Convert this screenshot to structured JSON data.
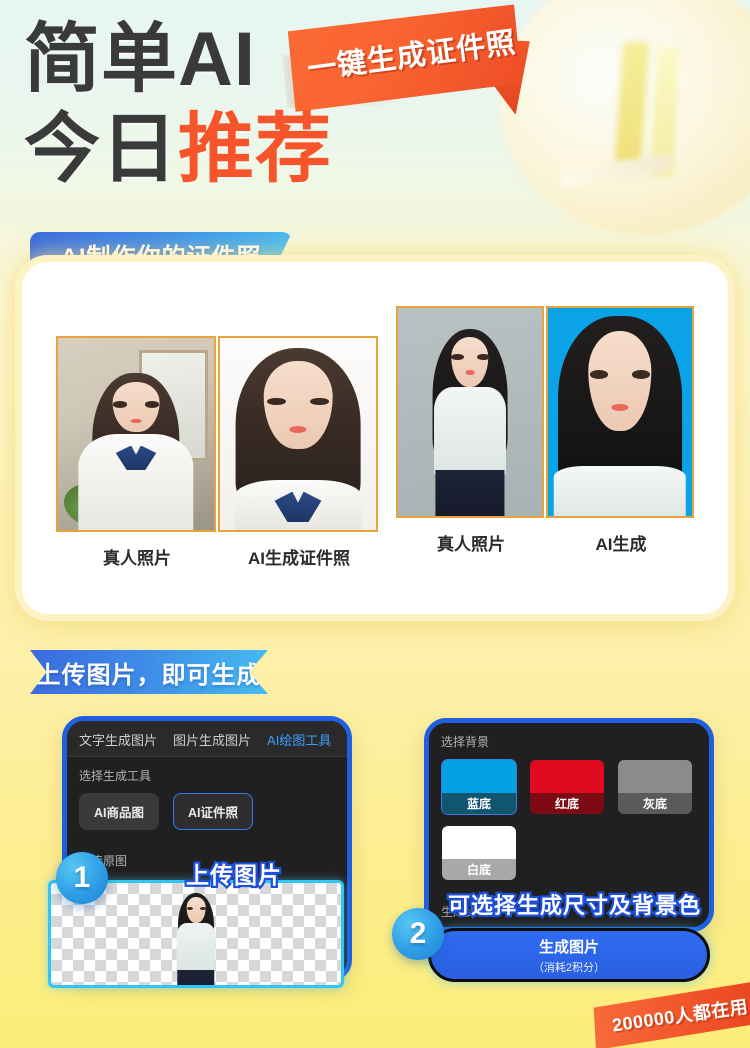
{
  "hero": {
    "line1": "简单AI",
    "line2_dark": "今日",
    "line2_accent": "推荐",
    "ribbon_label": "一键生成证件照"
  },
  "colors": {
    "accent_orange": "#f6552c",
    "brand_blue": "#1f5fe0",
    "tab_active_blue": "#3e9bff",
    "frame_gold": "#e8a33d",
    "page_bg_top": "#e8f6f1",
    "page_bg_bottom": "#fced78"
  },
  "section_one": {
    "heading": "AI制作你的证件照",
    "group_a": {
      "captions": [
        "真人照片",
        "AI生成证件照"
      ]
    },
    "group_b": {
      "captions": [
        "真人照片",
        "AI生成"
      ]
    }
  },
  "section_two": {
    "heading": "上传图片，即可生成",
    "step_one_badge": "1",
    "step_two_badge": "2",
    "overlay_caption_upload": "上传图片",
    "overlay_caption_size": "可选择生成尺寸及背景色",
    "panel_one": {
      "tabs": [
        {
          "label": "文字生成图片",
          "active": false
        },
        {
          "label": "图片生成图片",
          "active": false
        },
        {
          "label": "AI绘图工具",
          "active": true
        }
      ],
      "tool_label": "选择生成工具",
      "tools": [
        {
          "label": "AI商品图",
          "selected": false
        },
        {
          "label": "AI证件照",
          "selected": true
        }
      ],
      "upload_label": "上传原图"
    },
    "panel_two": {
      "bg_label": "选择背景",
      "backgrounds": [
        {
          "label": "蓝底",
          "selected": true
        },
        {
          "label": "红底",
          "selected": false
        },
        {
          "label": "灰底",
          "selected": false
        },
        {
          "label": "白底",
          "selected": false
        }
      ],
      "ratio_label": "生成比例",
      "generate_button": {
        "title": "生成图片",
        "subtitle": "（消耗2积分）"
      }
    }
  },
  "footer": {
    "banner_text": "200000人都在用"
  }
}
